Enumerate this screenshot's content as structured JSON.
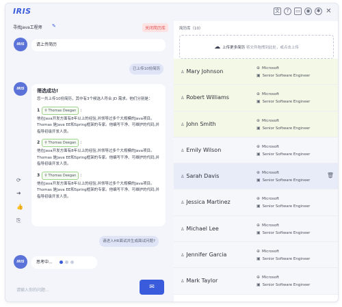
{
  "app": {
    "logo": "IRIS",
    "top_icons": [
      "translate-icon",
      "help-icon",
      "monitor-icon",
      "account-icon",
      "settings-icon",
      "close-icon"
    ]
  },
  "left": {
    "project_title": "寻找Java工程师",
    "close_label": "关闭简历库",
    "avatar_label": "IRIS",
    "ai_prompt": "请上传简历",
    "user_msg_1": "已上传10份简历",
    "ai_result_title": "筛选成功!",
    "ai_result_intro": "您一共上传10份简历，其中有3个候选人符合 JD 需求。他们分别是：",
    "candidates": [
      {
        "num": "1",
        "name": "Thomas Deegan",
        "desc": "他在Java开发方面有8年以上的经验,并领导过多个大规模的Java项目。Thomas 是Java EE和Spring框架的专家。他编写干净、可维护的代码,并指导初级开发人员。"
      },
      {
        "num": "2",
        "name": "Thomas Deegan",
        "desc": "他在Java开发方面有8年以上的经验,并领导过多个大规模的Java项目。Thomas 是Java EE和Spring框架的专家。他编写干净、可维护的代码,并指导初级开发人员。"
      },
      {
        "num": "3",
        "name": "Thomas Deegan",
        "desc": "他在Java开发方面有8年以上的经验,并领导过多个大规模的Java项目。Thomas 是Java EE和Spring框架的专家。他编写干净、可维护的代码,并指导初级开发人员。"
      }
    ],
    "user_msg_2": "请进入HR面试并生成面试问题?",
    "thinking": "思考中...",
    "input_placeholder": "请输入你的问题...",
    "side_icons": [
      "refresh-icon",
      "forward-icon",
      "thumbs-up-icon",
      "thumbs-down-icon"
    ]
  },
  "right": {
    "header": "简历库（10）",
    "upload_main": "上传更多简历",
    "upload_hint": "将文件拖拽到此处，或点击上传",
    "resumes": [
      {
        "name": "Mary Johnson",
        "company": "Microsoft",
        "role": "Senior Software Engineer",
        "highlight": "green"
      },
      {
        "name": "Robert Williams",
        "company": "Microsoft",
        "role": "Senior Software Engineer",
        "highlight": "green"
      },
      {
        "name": "John Smith",
        "company": "Microsoft",
        "role": "Senior Software Engineer",
        "highlight": "green"
      },
      {
        "name": "Emily Wilson",
        "company": "Microsoft",
        "role": "Senior Software Engineer",
        "highlight": "grey"
      },
      {
        "name": "Sarah Davis",
        "company": "Microsoft",
        "role": "Senior Software Engineer",
        "highlight": "blue"
      },
      {
        "name": "Jessica Martinez",
        "company": "Microsoft",
        "role": "Senior Software Engineer",
        "highlight": "grey"
      },
      {
        "name": "Michael Lee",
        "company": "Microsoft",
        "role": "Senior Software Engineer",
        "highlight": "grey"
      },
      {
        "name": "Jennifer Garcia",
        "company": "Microsoft",
        "role": "Senior Software Engineer",
        "highlight": "grey"
      },
      {
        "name": "Mark Taylor",
        "company": "Microsoft",
        "role": "Senior Software Engineer",
        "highlight": "grey"
      }
    ]
  },
  "colors": {
    "accent": "#3a5bdc",
    "danger": "#e05252",
    "highlight_green": "#f4f9e7",
    "highlight_blue": "#e8ecf9"
  }
}
